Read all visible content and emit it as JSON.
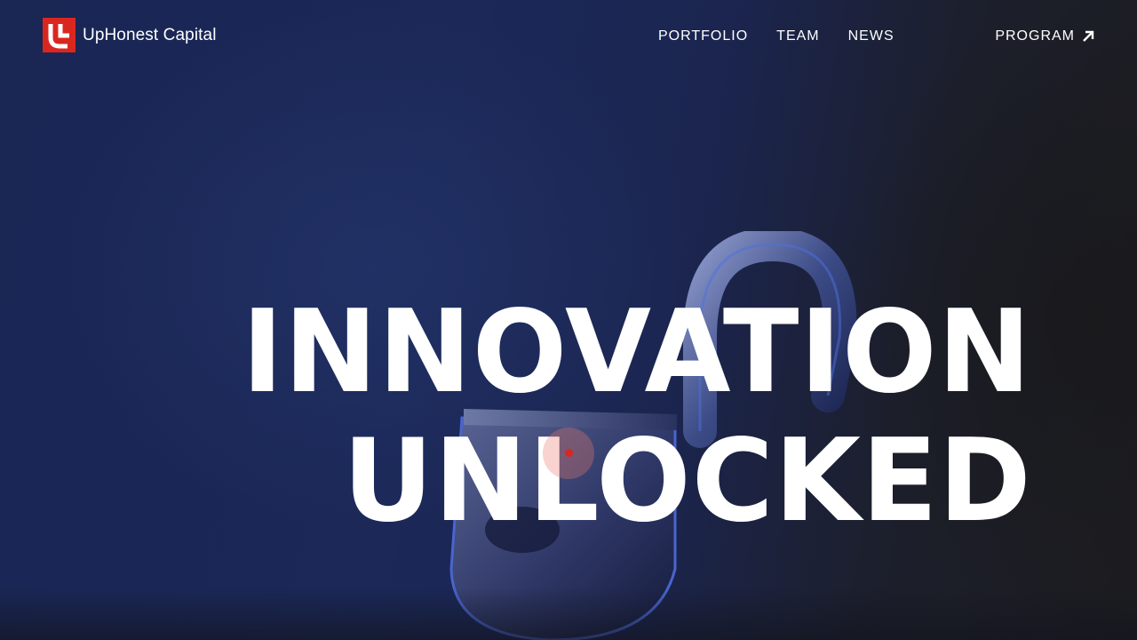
{
  "brand": {
    "name": "UpHonest Capital",
    "accent_color": "#d9271f"
  },
  "nav": {
    "items": [
      {
        "label": "PORTFOLIO"
      },
      {
        "label": "TEAM"
      },
      {
        "label": "NEWS"
      }
    ],
    "program_label": "PROGRAM",
    "program_icon": "arrow-up-right-icon"
  },
  "hero": {
    "line1": "INNOVATION",
    "line2": "UNLOCKED",
    "image": "padlock-icon"
  }
}
